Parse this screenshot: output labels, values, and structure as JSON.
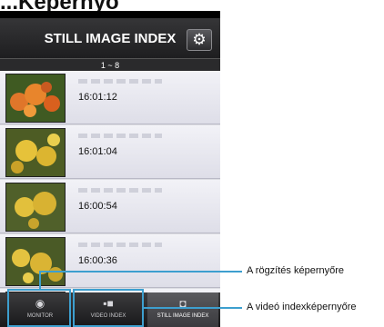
{
  "heading": "...Képernyő",
  "app": {
    "title": "STILL IMAGE INDEX",
    "settings_icon": "gear-icon",
    "range": "1 ~ 8"
  },
  "rows": [
    {
      "time": "16:01:12",
      "thumb": "orange-flowers"
    },
    {
      "time": "16:01:04",
      "thumb": "yellow-flowers"
    },
    {
      "time": "16:00:54",
      "thumb": "yellow-flowers"
    },
    {
      "time": "16:00:36",
      "thumb": "yellow-flowers"
    }
  ],
  "tabs": [
    {
      "label": "MONITOR",
      "icon": "camera-icon"
    },
    {
      "label": "VIDEO INDEX",
      "icon": "video-camera-icon"
    },
    {
      "label": "STILL IMAGE INDEX",
      "icon": "camera-icon",
      "active": true
    }
  ],
  "callouts": {
    "monitor": "A rögzítés képernyőre",
    "video_index": "A videó indexképernyőre"
  },
  "colors": {
    "highlight": "#3d9fcf"
  }
}
